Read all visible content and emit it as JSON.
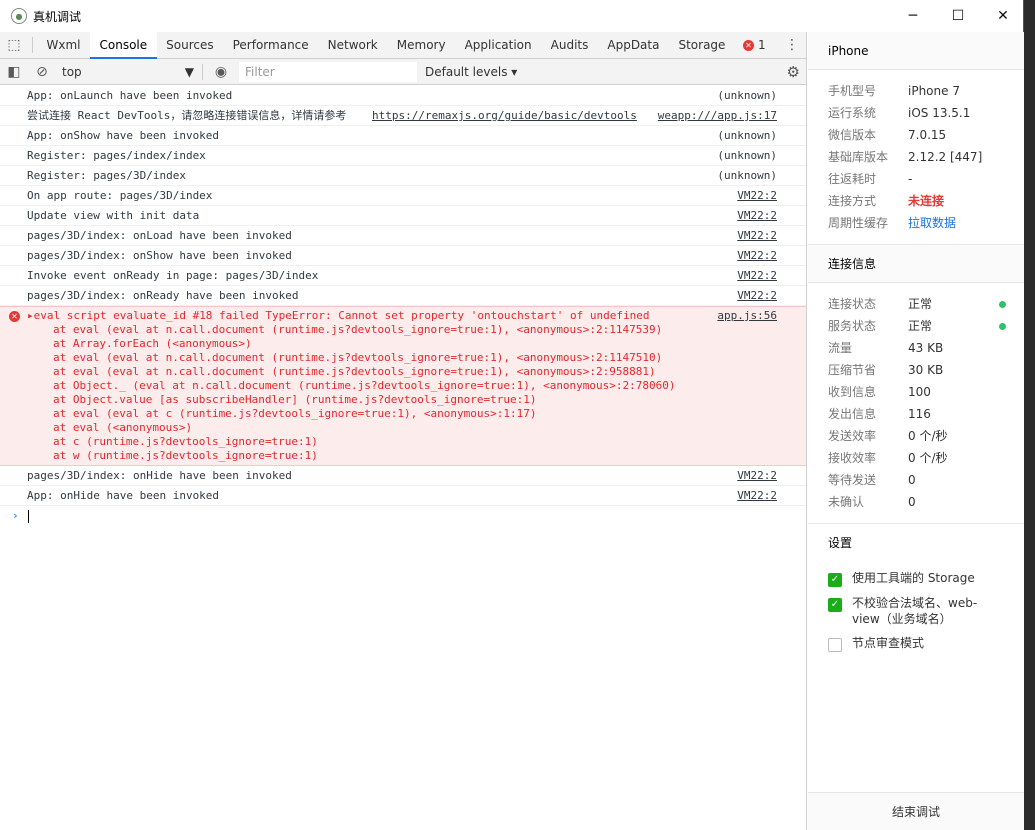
{
  "window": {
    "title": "真机调试"
  },
  "tabs": [
    "Wxml",
    "Console",
    "Sources",
    "Performance",
    "Network",
    "Memory",
    "Application",
    "Audits",
    "AppData",
    "Storage"
  ],
  "error_count": "1",
  "toolbar": {
    "context": "top",
    "filter_placeholder": "Filter",
    "levels": "Default levels"
  },
  "messages_top": [
    {
      "text": "App: onLaunch have been invoked",
      "src": "(unknown)"
    },
    {
      "text": "尝试连接 React DevTools，请忽略连接错误信息，详情请参考",
      "link": "https://remaxjs.org/guide/basic/devtools",
      "src": "weapp:///app.js:17"
    },
    {
      "text": "App: onShow have been invoked",
      "src": "(unknown)"
    },
    {
      "text": "Register: pages/index/index",
      "src": "(unknown)"
    },
    {
      "text": "Register: pages/3D/index",
      "src": "(unknown)"
    },
    {
      "text": "On app route: pages/3D/index",
      "src": "VM22:2"
    },
    {
      "text": "Update view with init data",
      "src": "VM22:2"
    },
    {
      "text": "pages/3D/index: onLoad have been invoked",
      "src": "VM22:2"
    },
    {
      "text": "pages/3D/index: onShow have been invoked",
      "src": "VM22:2"
    },
    {
      "text": "Invoke event onReady in page: pages/3D/index",
      "src": "VM22:2"
    },
    {
      "text": "pages/3D/index: onReady have been invoked",
      "src": "VM22:2"
    }
  ],
  "error": {
    "message": "eval script evaluate_id #18 failed TypeError: Cannot set property 'ontouchstart' of undefined",
    "src": "app.js:56",
    "stack": [
      "at eval (eval at n.call.document (runtime.js?devtools_ignore=true:1), <anonymous>:2:1147539)",
      "at Array.forEach (<anonymous>)",
      "at eval (eval at n.call.document (runtime.js?devtools_ignore=true:1), <anonymous>:2:1147510)",
      "at eval (eval at n.call.document (runtime.js?devtools_ignore=true:1), <anonymous>:2:958881)",
      "at Object._ (eval at n.call.document (runtime.js?devtools_ignore=true:1), <anonymous>:2:78060)",
      "at Object.value [as subscribeHandler] (runtime.js?devtools_ignore=true:1)",
      "at eval (eval at c (runtime.js?devtools_ignore=true:1), <anonymous>:1:17)",
      "at eval (<anonymous>)",
      "at c (runtime.js?devtools_ignore=true:1)",
      "at w (runtime.js?devtools_ignore=true:1)"
    ]
  },
  "messages_bottom": [
    {
      "text": "pages/3D/index: onHide have been invoked",
      "src": "VM22:2"
    },
    {
      "text": "App: onHide have been invoked",
      "src": "VM22:2"
    }
  ],
  "device": {
    "title": "iPhone",
    "rows": [
      {
        "k": "手机型号",
        "v": "iPhone 7"
      },
      {
        "k": "运行系统",
        "v": "iOS 13.5.1"
      },
      {
        "k": "微信版本",
        "v": "7.0.15"
      },
      {
        "k": "基础库版本",
        "v": "2.12.2 [447]"
      },
      {
        "k": "往返耗时",
        "v": "-"
      },
      {
        "k": "连接方式",
        "v": "未连接"
      },
      {
        "k": "周期性缓存",
        "v": "拉取数据"
      }
    ]
  },
  "connection": {
    "title": "连接信息",
    "rows": [
      {
        "k": "连接状态",
        "v": "正常"
      },
      {
        "k": "服务状态",
        "v": "正常"
      },
      {
        "k": "流量",
        "v": "43 KB"
      },
      {
        "k": "压缩节省",
        "v": "30 KB"
      },
      {
        "k": "收到信息",
        "v": "100"
      },
      {
        "k": "发出信息",
        "v": "116"
      },
      {
        "k": "发送效率",
        "v": "0 个/秒"
      },
      {
        "k": "接收效率",
        "v": "0 个/秒"
      },
      {
        "k": "等待发送",
        "v": "0"
      },
      {
        "k": "未确认",
        "v": "0"
      }
    ]
  },
  "settings": {
    "title": "设置",
    "options": [
      {
        "label": "使用工具端的 Storage",
        "checked": true
      },
      {
        "label": "不校验合法域名、web-view（业务域名）",
        "checked": true
      },
      {
        "label": "节点审查模式",
        "checked": false
      }
    ]
  },
  "end_button": "结束调试",
  "colors": {
    "accent": "#1a73e8",
    "error": "#e53935",
    "ok": "#2ec16a",
    "checkbox": "#1aad19"
  }
}
